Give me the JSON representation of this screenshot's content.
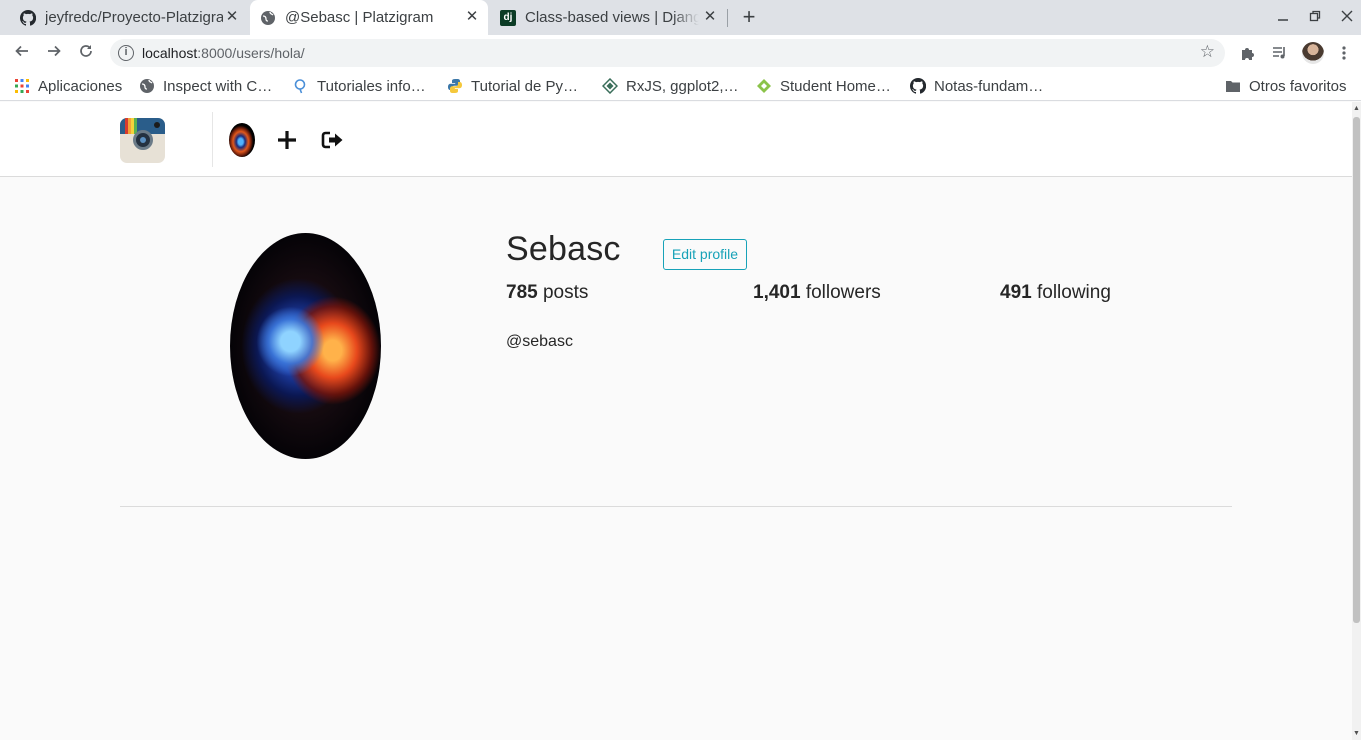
{
  "browser": {
    "tabs": [
      {
        "title": "jeyfredc/Proyecto-Platzigram",
        "icon": "github-icon"
      },
      {
        "title": "@Sebasc | Platzigram",
        "icon": "globe-icon",
        "active": true
      },
      {
        "title": "Class-based views | Django",
        "icon": "django-icon"
      }
    ],
    "new_tab": "+",
    "close_glyph": "✕",
    "address": {
      "host": "localhost",
      "rest": ":8000/users/hola/"
    },
    "bookmarks": [
      {
        "label": "Aplicaciones",
        "icon": "apps-grid-icon"
      },
      {
        "label": "Inspect with C…",
        "icon": "globe-icon"
      },
      {
        "label": "Tutoriales info…",
        "icon": "search-bubble-icon"
      },
      {
        "label": "Tutorial de Py…",
        "icon": "python-icon"
      },
      {
        "label": "RxJS, ggplot2,…",
        "icon": "diamond-icon"
      },
      {
        "label": "Student Home…",
        "icon": "green-diamond-icon"
      },
      {
        "label": "Notas-fundam…",
        "icon": "github-icon"
      }
    ],
    "other_bookmarks": "Otros favoritos"
  },
  "profile": {
    "username": "Sebasc",
    "edit_label": "Edit profile",
    "posts_count": "785",
    "posts_label": "posts",
    "followers_count": "1,401",
    "followers_label": "followers",
    "following_count": "491",
    "following_label": "following",
    "handle": "@sebasc"
  },
  "colors": {
    "accent": "#17a2b8",
    "page_bg": "#fafafa"
  }
}
